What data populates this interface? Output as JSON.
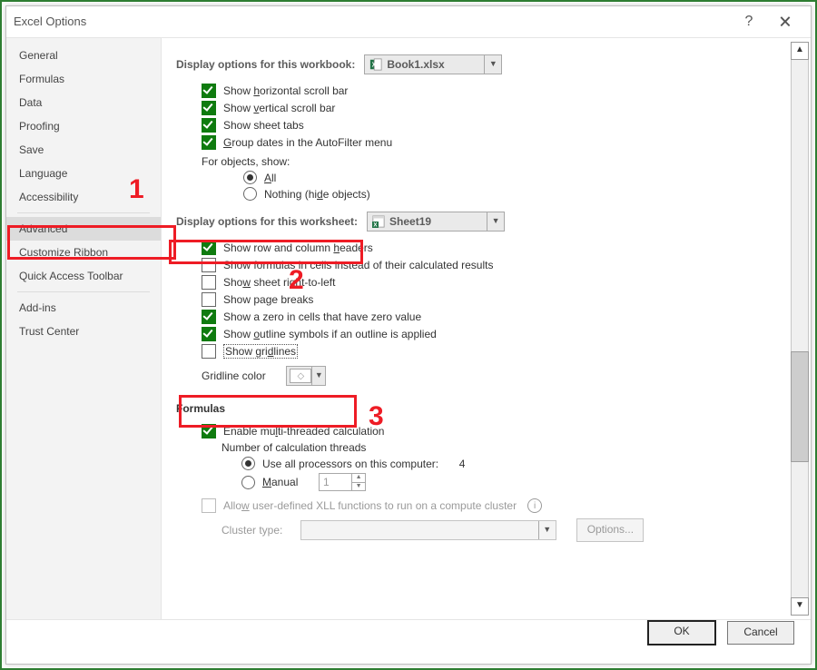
{
  "window": {
    "title": "Excel Options",
    "help": "?",
    "close": "🗙"
  },
  "sidebar": {
    "items": [
      {
        "label": "General"
      },
      {
        "label": "Formulas"
      },
      {
        "label": "Data"
      },
      {
        "label": "Proofing"
      },
      {
        "label": "Save"
      },
      {
        "label": "Language"
      },
      {
        "label": "Accessibility"
      },
      {
        "label": "Advanced",
        "selected": true
      },
      {
        "label": "Customize Ribbon"
      },
      {
        "label": "Quick Access Toolbar"
      },
      {
        "label": "Add-ins"
      },
      {
        "label": "Trust Center"
      }
    ],
    "separators_after": [
      6,
      9
    ]
  },
  "workbook_section": {
    "heading": "Display options for this workbook:",
    "combo": "Book1.xlsx",
    "options": {
      "h_scroll": {
        "label": "Show horizontal scroll bar",
        "checked": true,
        "u": "h"
      },
      "v_scroll": {
        "label_pre": "Show ",
        "u": "v",
        "label_post": "ertical scroll bar",
        "checked": true
      },
      "tabs": {
        "label": "Show sheet tabs",
        "checked": true
      },
      "group_dates": {
        "label_pre": "",
        "u": "G",
        "label_post": "roup dates in the AutoFilter menu",
        "checked": true
      },
      "objects_label": "For objects, show:",
      "radio_all": {
        "u": "A",
        "post": "ll",
        "on": true
      },
      "radio_nothing": {
        "label": "Nothing (hi",
        "u": "d",
        "post": "e objects)",
        "on": false
      }
    }
  },
  "worksheet_section": {
    "heading": "Display options for this worksheet:",
    "combo": "Sheet19",
    "options": {
      "row_col": {
        "label_pre": "Show row and column ",
        "u": "h",
        "label_post": "eaders",
        "checked": true
      },
      "formulas": {
        "label": "Show formulas in cells instead of their calculated results",
        "checked": false
      },
      "rtl": {
        "label_pre": "Sho",
        "u": "w",
        "label_post": " sheet right-to-left",
        "checked": false
      },
      "page_breaks": {
        "label": "Show page breaks",
        "checked": false
      },
      "zero": {
        "label": "Show a zero in cells that have zero value",
        "checked": true
      },
      "outline": {
        "label_pre": "Show ",
        "u": "o",
        "label_post": "utline symbols if an outline is applied",
        "checked": true
      },
      "gridlines": {
        "label_pre": "Show gri",
        "u": "d",
        "label_post": "lines",
        "checked": false
      },
      "grid_color_label": "Gridline color"
    }
  },
  "formulas_section": {
    "heading": "Formulas",
    "multi": {
      "label_pre": "Enable mu",
      "u": "l",
      "label_post": "ti-threaded calculation",
      "checked": true
    },
    "threads_label": "Number of calculation threads",
    "radio_all": {
      "label": "Use all processors on this computer:",
      "count": "4",
      "on": true
    },
    "radio_manual": {
      "u": "M",
      "post": "anual",
      "value": "1",
      "on": false
    },
    "xll": {
      "label_pre": "Allo",
      "u": "w",
      "label_post": " user-defined XLL functions to run on a compute cluster"
    },
    "cluster_label": "Cluster type:",
    "options_btn": "Options..."
  },
  "footer": {
    "ok": "OK",
    "cancel": "Cancel"
  },
  "annotations": {
    "n1": "1",
    "n2": "2",
    "n3": "3"
  }
}
